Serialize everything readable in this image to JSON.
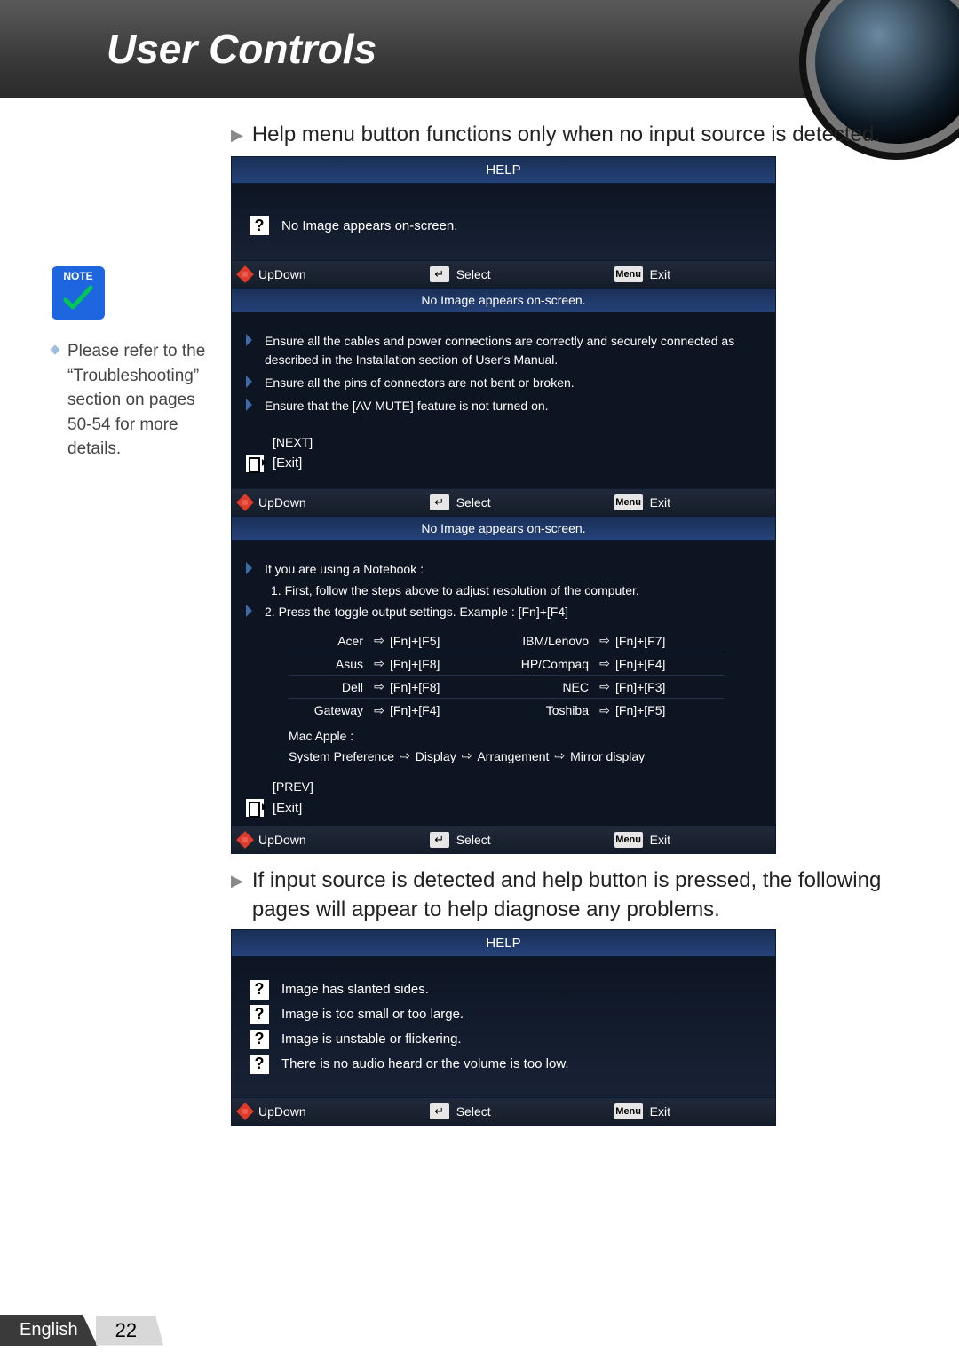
{
  "header": {
    "title": "User Controls"
  },
  "intro": {
    "text": "Help menu button functions only when no input source is detected."
  },
  "sidebar": {
    "note_label": "NOTE",
    "note_text": "Please refer to the “Troubleshooting” section on pages 50-54 for more details."
  },
  "osd": {
    "help_title": "HELP",
    "q_main": "No Image appears on-screen.",
    "nav": {
      "updown": "UpDown",
      "select": "Select",
      "exit": "Exit",
      "menu": "Menu"
    },
    "section_title": "No Image appears on-screen.",
    "tips1": [
      "Ensure all the cables and power connections are correctly and securely connected as described in the Installation section of User's Manual.",
      "Ensure all the pins of connectors are not bent or broken.",
      "Ensure that the [AV MUTE] feature is not turned on."
    ],
    "next_label": "[NEXT]",
    "exit_label": "[Exit]",
    "tips2_intro": "If you are using a Notebook :",
    "tips2_steps": [
      "1. First, follow the steps above to adjust resolution of the computer.",
      "2. Press the toggle output settings. Example : [Fn]+[F4]"
    ],
    "vendor_rows": [
      {
        "b1": "Acer",
        "k1": "[Fn]+[F5]",
        "b2": "IBM/Lenovo",
        "k2": "[Fn]+[F7]"
      },
      {
        "b1": "Asus",
        "k1": "[Fn]+[F8]",
        "b2": "HP/Compaq",
        "k2": "[Fn]+[F4]"
      },
      {
        "b1": "Dell",
        "k1": "[Fn]+[F8]",
        "b2": "NEC",
        "k2": "[Fn]+[F3]"
      },
      {
        "b1": "Gateway",
        "k1": "[Fn]+[F4]",
        "b2": "Toshiba",
        "k2": "[Fn]+[F5]"
      }
    ],
    "mac_label": "Mac Apple :",
    "mac_steps": [
      "System Preference",
      "Display",
      "Arrangement",
      "Mirror display"
    ],
    "prev_label": "[PREV]"
  },
  "mid_text": "If input source is detected and help button is pressed, the following pages will appear to help diagnose any problems.",
  "diag_items": [
    "Image has slanted sides.",
    "Image is too small or too large.",
    "Image is unstable or flickering.",
    "There is no audio heard or the volume is too low."
  ],
  "footer": {
    "lang": "English",
    "page": "22"
  }
}
